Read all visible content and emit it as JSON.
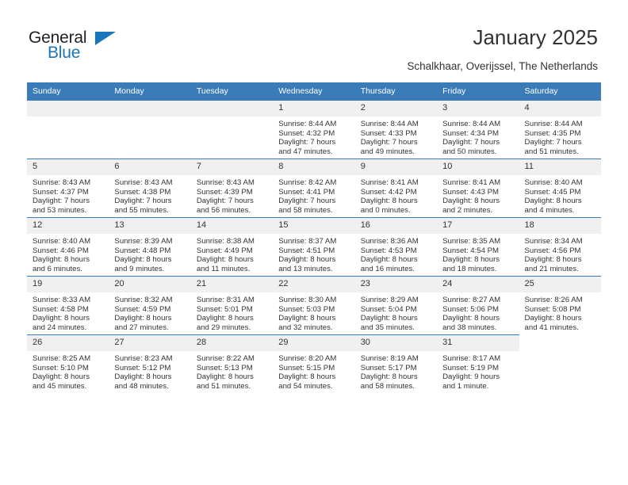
{
  "brand": {
    "name_part1": "General",
    "name_part2": "Blue",
    "accent_color": "#1b75bb",
    "triangle_icon": "brand-triangle-icon"
  },
  "header": {
    "title": "January 2025",
    "subtitle": "Schalkhaar, Overijssel, The Netherlands"
  },
  "calendar": {
    "header_bg": "#3b7cb8",
    "daynum_bg": "#f0f0f0",
    "weekdays": [
      "Sunday",
      "Monday",
      "Tuesday",
      "Wednesday",
      "Thursday",
      "Friday",
      "Saturday"
    ],
    "weeks": [
      [
        {
          "day": "",
          "lines": []
        },
        {
          "day": "",
          "lines": []
        },
        {
          "day": "",
          "lines": []
        },
        {
          "day": "1",
          "lines": [
            "Sunrise: 8:44 AM",
            "Sunset: 4:32 PM",
            "Daylight: 7 hours",
            "and 47 minutes."
          ]
        },
        {
          "day": "2",
          "lines": [
            "Sunrise: 8:44 AM",
            "Sunset: 4:33 PM",
            "Daylight: 7 hours",
            "and 49 minutes."
          ]
        },
        {
          "day": "3",
          "lines": [
            "Sunrise: 8:44 AM",
            "Sunset: 4:34 PM",
            "Daylight: 7 hours",
            "and 50 minutes."
          ]
        },
        {
          "day": "4",
          "lines": [
            "Sunrise: 8:44 AM",
            "Sunset: 4:35 PM",
            "Daylight: 7 hours",
            "and 51 minutes."
          ]
        }
      ],
      [
        {
          "day": "5",
          "lines": [
            "Sunrise: 8:43 AM",
            "Sunset: 4:37 PM",
            "Daylight: 7 hours",
            "and 53 minutes."
          ]
        },
        {
          "day": "6",
          "lines": [
            "Sunrise: 8:43 AM",
            "Sunset: 4:38 PM",
            "Daylight: 7 hours",
            "and 55 minutes."
          ]
        },
        {
          "day": "7",
          "lines": [
            "Sunrise: 8:43 AM",
            "Sunset: 4:39 PM",
            "Daylight: 7 hours",
            "and 56 minutes."
          ]
        },
        {
          "day": "8",
          "lines": [
            "Sunrise: 8:42 AM",
            "Sunset: 4:41 PM",
            "Daylight: 7 hours",
            "and 58 minutes."
          ]
        },
        {
          "day": "9",
          "lines": [
            "Sunrise: 8:41 AM",
            "Sunset: 4:42 PM",
            "Daylight: 8 hours",
            "and 0 minutes."
          ]
        },
        {
          "day": "10",
          "lines": [
            "Sunrise: 8:41 AM",
            "Sunset: 4:43 PM",
            "Daylight: 8 hours",
            "and 2 minutes."
          ]
        },
        {
          "day": "11",
          "lines": [
            "Sunrise: 8:40 AM",
            "Sunset: 4:45 PM",
            "Daylight: 8 hours",
            "and 4 minutes."
          ]
        }
      ],
      [
        {
          "day": "12",
          "lines": [
            "Sunrise: 8:40 AM",
            "Sunset: 4:46 PM",
            "Daylight: 8 hours",
            "and 6 minutes."
          ]
        },
        {
          "day": "13",
          "lines": [
            "Sunrise: 8:39 AM",
            "Sunset: 4:48 PM",
            "Daylight: 8 hours",
            "and 9 minutes."
          ]
        },
        {
          "day": "14",
          "lines": [
            "Sunrise: 8:38 AM",
            "Sunset: 4:49 PM",
            "Daylight: 8 hours",
            "and 11 minutes."
          ]
        },
        {
          "day": "15",
          "lines": [
            "Sunrise: 8:37 AM",
            "Sunset: 4:51 PM",
            "Daylight: 8 hours",
            "and 13 minutes."
          ]
        },
        {
          "day": "16",
          "lines": [
            "Sunrise: 8:36 AM",
            "Sunset: 4:53 PM",
            "Daylight: 8 hours",
            "and 16 minutes."
          ]
        },
        {
          "day": "17",
          "lines": [
            "Sunrise: 8:35 AM",
            "Sunset: 4:54 PM",
            "Daylight: 8 hours",
            "and 18 minutes."
          ]
        },
        {
          "day": "18",
          "lines": [
            "Sunrise: 8:34 AM",
            "Sunset: 4:56 PM",
            "Daylight: 8 hours",
            "and 21 minutes."
          ]
        }
      ],
      [
        {
          "day": "19",
          "lines": [
            "Sunrise: 8:33 AM",
            "Sunset: 4:58 PM",
            "Daylight: 8 hours",
            "and 24 minutes."
          ]
        },
        {
          "day": "20",
          "lines": [
            "Sunrise: 8:32 AM",
            "Sunset: 4:59 PM",
            "Daylight: 8 hours",
            "and 27 minutes."
          ]
        },
        {
          "day": "21",
          "lines": [
            "Sunrise: 8:31 AM",
            "Sunset: 5:01 PM",
            "Daylight: 8 hours",
            "and 29 minutes."
          ]
        },
        {
          "day": "22",
          "lines": [
            "Sunrise: 8:30 AM",
            "Sunset: 5:03 PM",
            "Daylight: 8 hours",
            "and 32 minutes."
          ]
        },
        {
          "day": "23",
          "lines": [
            "Sunrise: 8:29 AM",
            "Sunset: 5:04 PM",
            "Daylight: 8 hours",
            "and 35 minutes."
          ]
        },
        {
          "day": "24",
          "lines": [
            "Sunrise: 8:27 AM",
            "Sunset: 5:06 PM",
            "Daylight: 8 hours",
            "and 38 minutes."
          ]
        },
        {
          "day": "25",
          "lines": [
            "Sunrise: 8:26 AM",
            "Sunset: 5:08 PM",
            "Daylight: 8 hours",
            "and 41 minutes."
          ]
        }
      ],
      [
        {
          "day": "26",
          "lines": [
            "Sunrise: 8:25 AM",
            "Sunset: 5:10 PM",
            "Daylight: 8 hours",
            "and 45 minutes."
          ]
        },
        {
          "day": "27",
          "lines": [
            "Sunrise: 8:23 AM",
            "Sunset: 5:12 PM",
            "Daylight: 8 hours",
            "and 48 minutes."
          ]
        },
        {
          "day": "28",
          "lines": [
            "Sunrise: 8:22 AM",
            "Sunset: 5:13 PM",
            "Daylight: 8 hours",
            "and 51 minutes."
          ]
        },
        {
          "day": "29",
          "lines": [
            "Sunrise: 8:20 AM",
            "Sunset: 5:15 PM",
            "Daylight: 8 hours",
            "and 54 minutes."
          ]
        },
        {
          "day": "30",
          "lines": [
            "Sunrise: 8:19 AM",
            "Sunset: 5:17 PM",
            "Daylight: 8 hours",
            "and 58 minutes."
          ]
        },
        {
          "day": "31",
          "lines": [
            "Sunrise: 8:17 AM",
            "Sunset: 5:19 PM",
            "Daylight: 9 hours",
            "and 1 minute."
          ]
        }
      ]
    ]
  }
}
